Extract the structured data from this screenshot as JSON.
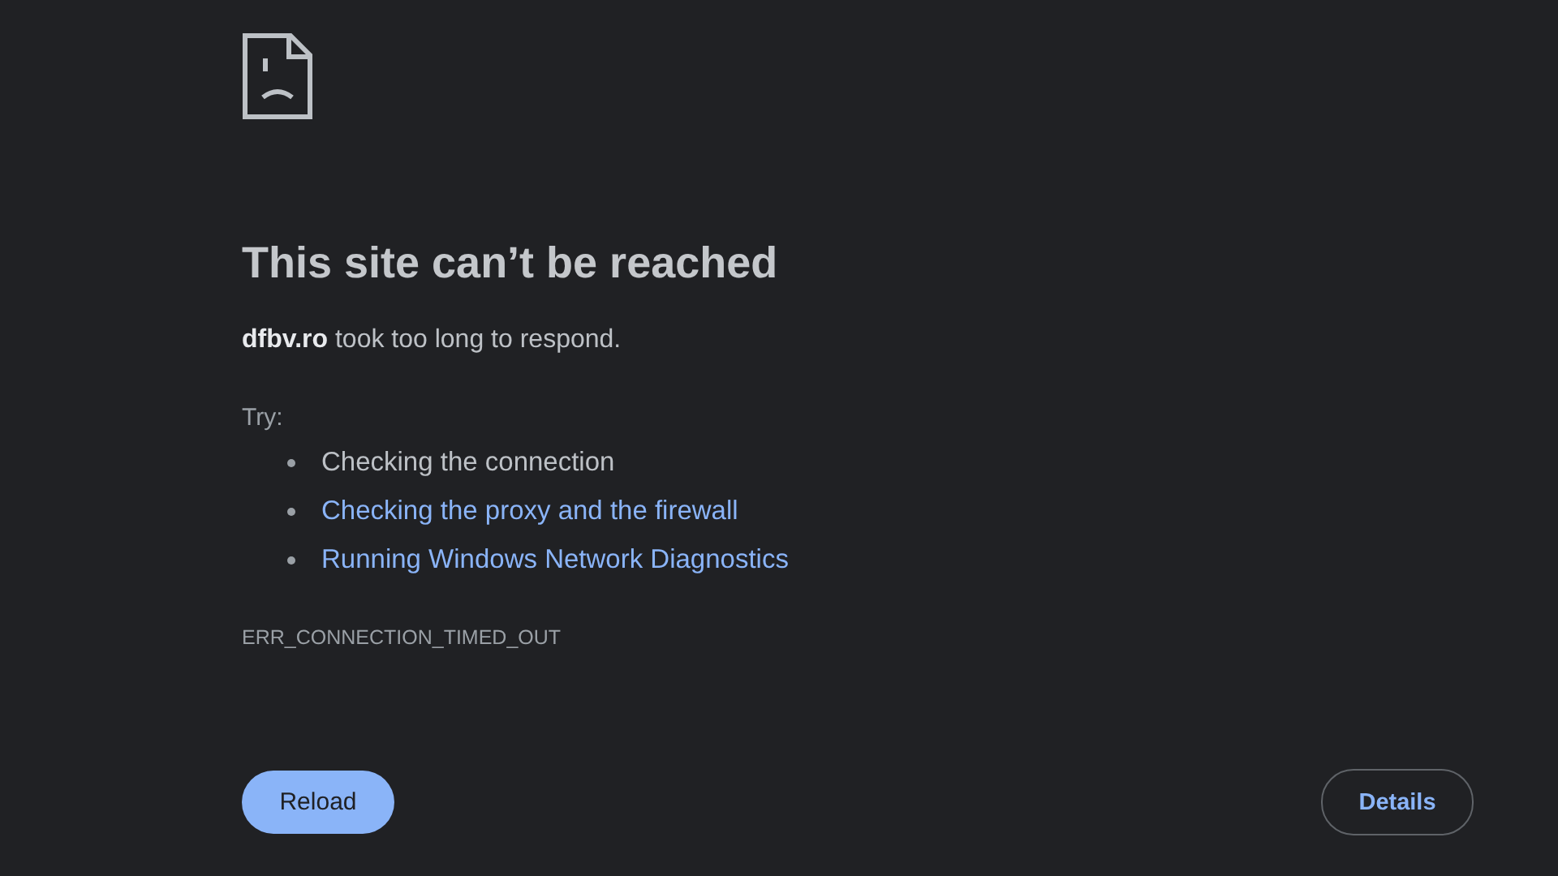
{
  "title": "This site can’t be reached",
  "message": "**dfbv.ro** took too long to respond.",
  "try_label": "Try:",
  "suggestions": [
    {
      "kind": "text",
      "label": "Checking the connection"
    },
    {
      "kind": "link",
      "label": "Checking the proxy and the firewall"
    },
    {
      "kind": "link",
      "label": "Running Windows Network Diagnostics"
    }
  ],
  "error_code": "ERR_CONNECTION_TIMED_OUT",
  "buttons": [
    {
      "kind": "primary",
      "label": "Reload"
    },
    {
      "kind": "outline",
      "label": "Details"
    }
  ]
}
